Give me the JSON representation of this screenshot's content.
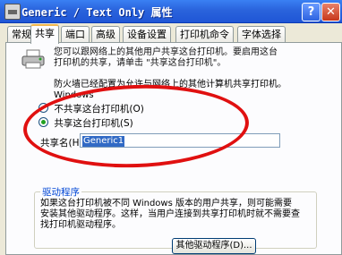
{
  "window": {
    "title": "Generic / Text Only 属性",
    "help": "?",
    "close": "✕"
  },
  "tabs": [
    {
      "label": "常规"
    },
    {
      "label": "共享"
    },
    {
      "label": "端口"
    },
    {
      "label": "高级"
    },
    {
      "label": "设备设置"
    },
    {
      "label": "打印机命令"
    },
    {
      "label": "字体选择"
    }
  ],
  "sharing": {
    "description": "您可以跟网络上的其他用户共享这台打印机。要启用这台打印机的共享，请单击 \"共享这台打印机\"。",
    "note": "防火墙已经配置为允许与网络上的其他计算机共享打印机。",
    "note_suffix": "Windows",
    "options": [
      {
        "label": "不共享这台打印机(O)",
        "checked": false
      },
      {
        "label": "共享这台打印机(S)",
        "checked": true
      }
    ],
    "share_name_label": "共享名(H):",
    "share_name_value": "Generic1"
  },
  "drivers": {
    "title": "驱动程序",
    "text": "如果这台打印机被不同 Windows 版本的用户共享，则可能需要安装其他驱动程序。这样，当用户连接到共享打印机时就不需要查找打印机驱动程序。",
    "button": "其他驱动程序(D)..."
  },
  "colors": {
    "annotation": "#e01010",
    "titlebar": "#2a63dc"
  }
}
